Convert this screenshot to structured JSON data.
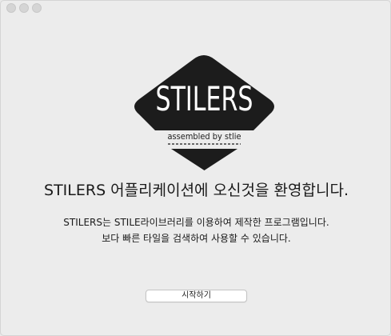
{
  "window": {
    "controls": [
      "close",
      "minimize",
      "maximize"
    ]
  },
  "logo": {
    "wordmark": "STILERS",
    "tagline": "assembled by stlie"
  },
  "main": {
    "welcome": "STILERS 어플리케이션에 오신것을 환영합니다.",
    "description_line1": "STILERS는 STILE라이브러리를 이용하여 제작한 프로그램입니다.",
    "description_line2": "보다 빠른 타일을 검색하여 사용할 수 있습니다.",
    "start_button": "시작하기"
  },
  "colors": {
    "window_bg": "#ececec",
    "logo_fill": "#1c1c1c",
    "text": "#1a1a1a"
  }
}
